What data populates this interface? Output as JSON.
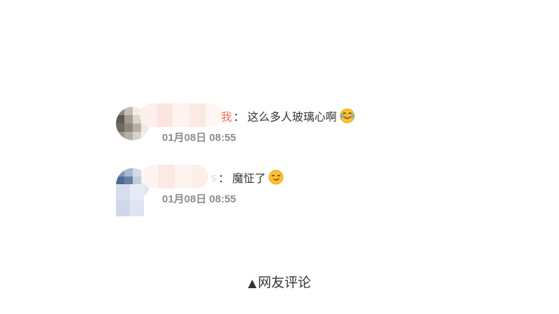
{
  "comments": [
    {
      "name_visible": "我",
      "colon": "：",
      "text": "这么多人玻璃心啊",
      "emoji": "laughing-tears-emoji",
      "time": "01月08日 08:55"
    },
    {
      "name_visible": "s",
      "colon": "：",
      "text": "魔怔了",
      "emoji": "smirk-emoji",
      "time": "01月08日 08:55"
    }
  ],
  "footer": {
    "arrow": "▲",
    "label": "网友评论"
  },
  "colors": {
    "name_accent": "#eb7350",
    "text": "#333333",
    "time": "#8c8c8c"
  }
}
